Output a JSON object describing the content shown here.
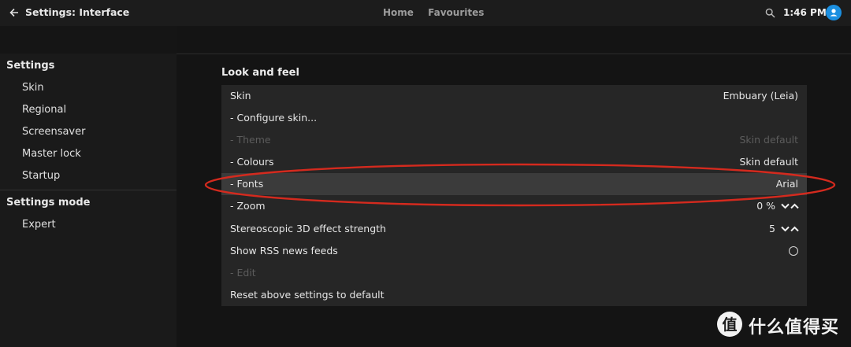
{
  "header": {
    "title": "Settings: Interface",
    "nav": [
      "Home",
      "Favourites"
    ],
    "time": "1:46 PM"
  },
  "sidebar": {
    "sections": [
      {
        "heading": "Settings",
        "items": [
          "Skin",
          "Regional",
          "Screensaver",
          "Master lock",
          "Startup"
        ]
      },
      {
        "heading": "Settings mode",
        "items": [
          "Expert"
        ]
      }
    ]
  },
  "main": {
    "section_title": "Look and feel",
    "rows": [
      {
        "label": "Skin",
        "value": "Embuary (Leia)"
      },
      {
        "label": "- Configure skin...",
        "value": ""
      },
      {
        "label": "- Theme",
        "value": "Skin default",
        "disabled": true
      },
      {
        "label": "- Colours",
        "value": "Skin default"
      },
      {
        "label": "- Fonts",
        "value": "Arial",
        "focused": true
      },
      {
        "label": "- Zoom",
        "value": "0 %",
        "spinner": true
      },
      {
        "label": "Stereoscopic 3D effect strength",
        "value": "5",
        "spinner": true
      },
      {
        "label": "Show RSS news feeds",
        "value": "",
        "radio": true
      },
      {
        "label": "- Edit",
        "value": "",
        "disabled": true
      },
      {
        "label": "Reset above settings to default",
        "value": ""
      }
    ]
  },
  "colors": {
    "accent_avatar": "#1b8fe0",
    "annotation_ring": "#d42a1e"
  },
  "watermark": {
    "text": "什么值得买"
  }
}
